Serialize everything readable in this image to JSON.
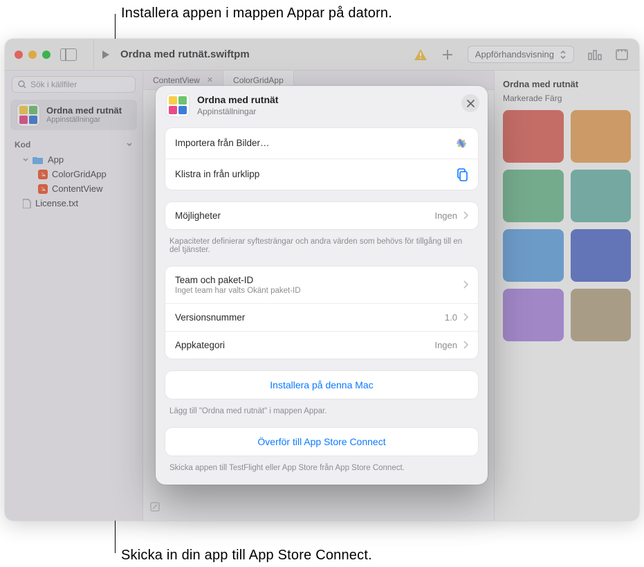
{
  "callouts": {
    "top": "Installera appen i mappen Appar på datorn.",
    "bottom": "Skicka in din app till App Store Connect."
  },
  "titlebar": {
    "title": "Ordna med rutnät.swiftpm",
    "preview_dropdown": "Appförhandsvisning"
  },
  "sidebar": {
    "search_placeholder": "Sök i källfiler",
    "project_title": "Ordna med rutnät",
    "project_sub": "Appinställningar",
    "section": "Kod",
    "tree": {
      "app": "App",
      "file1": "ColorGridApp",
      "file2": "ContentView",
      "file3": "License.txt"
    }
  },
  "tabs": {
    "tab1": "ContentView",
    "tab2": "ColorGridApp"
  },
  "preview": {
    "title": "Ordna med rutnät",
    "sub": "Markerade Färg",
    "colors": [
      "#df6a60",
      "#e9a65f",
      "#75bd93",
      "#73b9ae",
      "#6aa8e3",
      "#5d75cc",
      "#b08de0",
      "#bba98b"
    ]
  },
  "sheet": {
    "title": "Ordna med rutnät",
    "sub": "Appinställningar",
    "import_label": "Importera från Bilder…",
    "paste_label": "Klistra in från urklipp",
    "capabilities_label": "Möjligheter",
    "capabilities_value": "Ingen",
    "capabilities_note": "Kapaciteter definierar syftesträngar och andra värden som behövs för tillgång till en del tjänster.",
    "team_label": "Team och paket-ID",
    "team_sub": "Inget team har valts Okänt paket-ID",
    "version_label": "Versionsnummer",
    "version_value": "1.0",
    "category_label": "Appkategori",
    "category_value": "Ingen",
    "install_label": "Installera på denna Mac",
    "install_note": "Lägg till \"Ordna med rutnät\" i mappen Appar.",
    "upload_label": "Överför till App Store Connect",
    "upload_note": "Skicka appen till TestFlight eller App Store från App Store Connect."
  }
}
